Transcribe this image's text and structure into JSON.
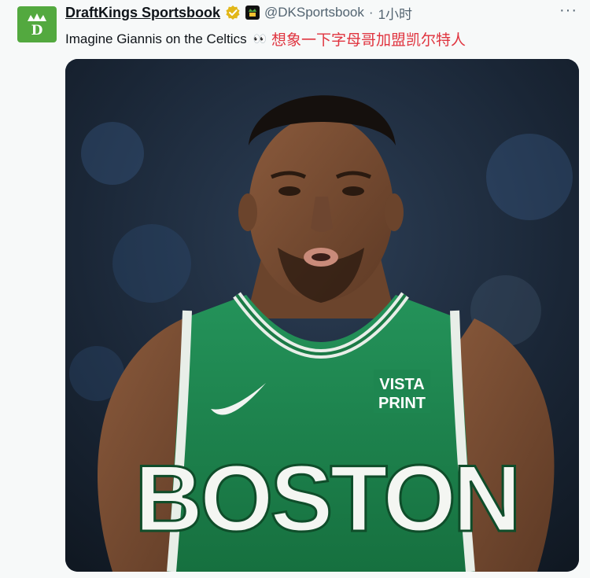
{
  "account": {
    "display_name": "DraftKings Sportsbook",
    "handle": "@DKSportsbook",
    "separator": "·",
    "time": "1小时",
    "avatar_icon": "draftkings-crown-icon",
    "verified_icon": "verified-badge-icon",
    "brand_color": "#53a93f"
  },
  "tweet": {
    "text": "Imagine Giannis on the Celtics",
    "emoji": "👀",
    "translation": "想象一下字母哥加盟凯尔特人",
    "translation_color": "#e0343f"
  },
  "menu": {
    "more_label": "···"
  },
  "media": {
    "jersey_color": "#1f8a4f",
    "jersey_text": "BOSTON",
    "sponsor_line1": "VISTA",
    "sponsor_line2": "PRINT"
  }
}
